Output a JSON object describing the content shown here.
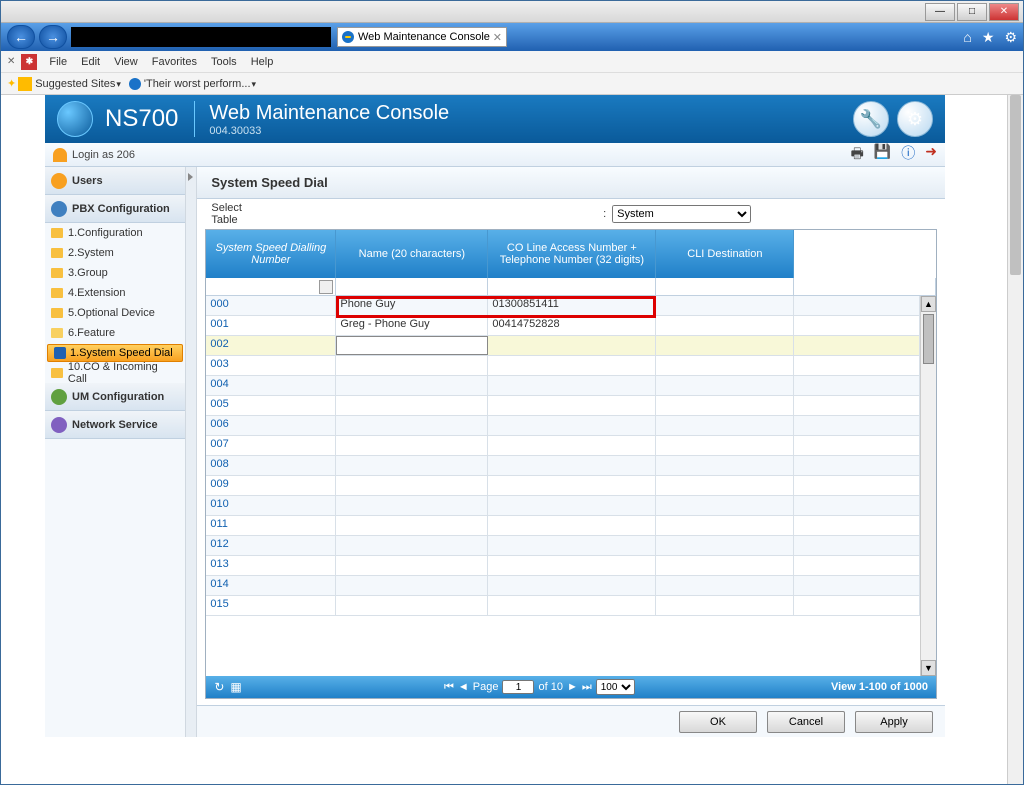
{
  "window": {
    "title": "Web Maintenance Console"
  },
  "browser": {
    "tab_title": "Web Maintenance Console",
    "menus": [
      "File",
      "Edit",
      "View",
      "Favorites",
      "Tools",
      "Help"
    ],
    "fav_links": {
      "suggested": "Suggested Sites",
      "worst": "'Their worst perform..."
    }
  },
  "header": {
    "brand": "NS700",
    "title": "Web Maintenance Console",
    "version": "004.30033"
  },
  "login": {
    "text": "Login as 206"
  },
  "sidebar": {
    "users": "Users",
    "pbx": "PBX Configuration",
    "pbx_items": [
      "1.Configuration",
      "2.System",
      "3.Group",
      "4.Extension",
      "5.Optional Device",
      "6.Feature"
    ],
    "feature_sub": [
      "1.System Speed Dial",
      "10.CO & Incoming Call"
    ],
    "um": "UM Configuration",
    "net": "Network Service"
  },
  "panel": {
    "title": "System Speed Dial",
    "select_table": "Select Table",
    "table_value": "System"
  },
  "columns": {
    "c1": "System Speed Dialling Number",
    "c2": "Name (20 characters)",
    "c3": "CO Line Access Number + Telephone Number (32 digits)",
    "c4": "CLI Destination"
  },
  "rows": [
    {
      "num": "000",
      "name": "Phone Guy",
      "tel": "01300851411",
      "cli": ""
    },
    {
      "num": "001",
      "name": "Greg - Phone Guy",
      "tel": "00414752828",
      "cli": ""
    },
    {
      "num": "002",
      "name": "",
      "tel": "",
      "cli": "",
      "editing": true
    },
    {
      "num": "003",
      "name": "",
      "tel": "",
      "cli": ""
    },
    {
      "num": "004",
      "name": "",
      "tel": "",
      "cli": ""
    },
    {
      "num": "005",
      "name": "",
      "tel": "",
      "cli": ""
    },
    {
      "num": "006",
      "name": "",
      "tel": "",
      "cli": ""
    },
    {
      "num": "007",
      "name": "",
      "tel": "",
      "cli": ""
    },
    {
      "num": "008",
      "name": "",
      "tel": "",
      "cli": ""
    },
    {
      "num": "009",
      "name": "",
      "tel": "",
      "cli": ""
    },
    {
      "num": "010",
      "name": "",
      "tel": "",
      "cli": ""
    },
    {
      "num": "011",
      "name": "",
      "tel": "",
      "cli": ""
    },
    {
      "num": "012",
      "name": "",
      "tel": "",
      "cli": ""
    },
    {
      "num": "013",
      "name": "",
      "tel": "",
      "cli": ""
    },
    {
      "num": "014",
      "name": "",
      "tel": "",
      "cli": ""
    },
    {
      "num": "015",
      "name": "",
      "tel": "",
      "cli": ""
    }
  ],
  "pager": {
    "page_label": "Page",
    "page": "1",
    "of": "of 10",
    "per_page": "100",
    "view_text": "View 1-100 of 1000"
  },
  "buttons": {
    "ok": "OK",
    "cancel": "Cancel",
    "apply": "Apply"
  }
}
